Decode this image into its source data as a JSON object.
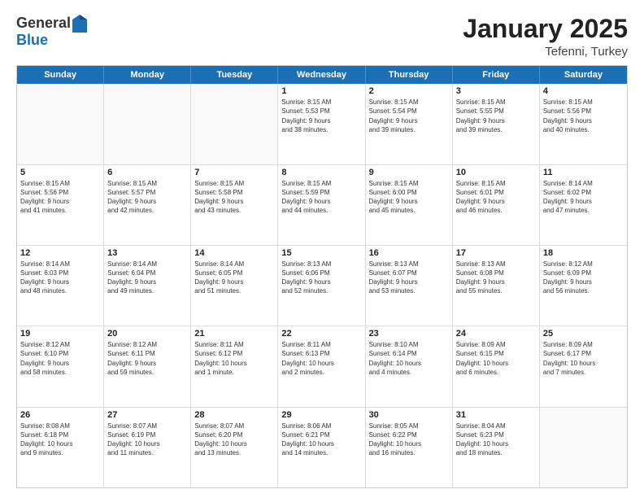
{
  "header": {
    "logo_general": "General",
    "logo_blue": "Blue",
    "month_year": "January 2025",
    "location": "Tefenni, Turkey"
  },
  "weekdays": [
    "Sunday",
    "Monday",
    "Tuesday",
    "Wednesday",
    "Thursday",
    "Friday",
    "Saturday"
  ],
  "weeks": [
    [
      {
        "day": "",
        "text": "",
        "empty": true
      },
      {
        "day": "",
        "text": "",
        "empty": true
      },
      {
        "day": "",
        "text": "",
        "empty": true
      },
      {
        "day": "1",
        "text": "Sunrise: 8:15 AM\nSunset: 5:53 PM\nDaylight: 9 hours\nand 38 minutes."
      },
      {
        "day": "2",
        "text": "Sunrise: 8:15 AM\nSunset: 5:54 PM\nDaylight: 9 hours\nand 39 minutes."
      },
      {
        "day": "3",
        "text": "Sunrise: 8:15 AM\nSunset: 5:55 PM\nDaylight: 9 hours\nand 39 minutes."
      },
      {
        "day": "4",
        "text": "Sunrise: 8:15 AM\nSunset: 5:56 PM\nDaylight: 9 hours\nand 40 minutes."
      }
    ],
    [
      {
        "day": "5",
        "text": "Sunrise: 8:15 AM\nSunset: 5:56 PM\nDaylight: 9 hours\nand 41 minutes."
      },
      {
        "day": "6",
        "text": "Sunrise: 8:15 AM\nSunset: 5:57 PM\nDaylight: 9 hours\nand 42 minutes."
      },
      {
        "day": "7",
        "text": "Sunrise: 8:15 AM\nSunset: 5:58 PM\nDaylight: 9 hours\nand 43 minutes."
      },
      {
        "day": "8",
        "text": "Sunrise: 8:15 AM\nSunset: 5:59 PM\nDaylight: 9 hours\nand 44 minutes."
      },
      {
        "day": "9",
        "text": "Sunrise: 8:15 AM\nSunset: 6:00 PM\nDaylight: 9 hours\nand 45 minutes."
      },
      {
        "day": "10",
        "text": "Sunrise: 8:15 AM\nSunset: 6:01 PM\nDaylight: 9 hours\nand 46 minutes."
      },
      {
        "day": "11",
        "text": "Sunrise: 8:14 AM\nSunset: 6:02 PM\nDaylight: 9 hours\nand 47 minutes."
      }
    ],
    [
      {
        "day": "12",
        "text": "Sunrise: 8:14 AM\nSunset: 6:03 PM\nDaylight: 9 hours\nand 48 minutes."
      },
      {
        "day": "13",
        "text": "Sunrise: 8:14 AM\nSunset: 6:04 PM\nDaylight: 9 hours\nand 49 minutes."
      },
      {
        "day": "14",
        "text": "Sunrise: 8:14 AM\nSunset: 6:05 PM\nDaylight: 9 hours\nand 51 minutes."
      },
      {
        "day": "15",
        "text": "Sunrise: 8:13 AM\nSunset: 6:06 PM\nDaylight: 9 hours\nand 52 minutes."
      },
      {
        "day": "16",
        "text": "Sunrise: 8:13 AM\nSunset: 6:07 PM\nDaylight: 9 hours\nand 53 minutes."
      },
      {
        "day": "17",
        "text": "Sunrise: 8:13 AM\nSunset: 6:08 PM\nDaylight: 9 hours\nand 55 minutes."
      },
      {
        "day": "18",
        "text": "Sunrise: 8:12 AM\nSunset: 6:09 PM\nDaylight: 9 hours\nand 56 minutes."
      }
    ],
    [
      {
        "day": "19",
        "text": "Sunrise: 8:12 AM\nSunset: 6:10 PM\nDaylight: 9 hours\nand 58 minutes."
      },
      {
        "day": "20",
        "text": "Sunrise: 8:12 AM\nSunset: 6:11 PM\nDaylight: 9 hours\nand 59 minutes."
      },
      {
        "day": "21",
        "text": "Sunrise: 8:11 AM\nSunset: 6:12 PM\nDaylight: 10 hours\nand 1 minute."
      },
      {
        "day": "22",
        "text": "Sunrise: 8:11 AM\nSunset: 6:13 PM\nDaylight: 10 hours\nand 2 minutes."
      },
      {
        "day": "23",
        "text": "Sunrise: 8:10 AM\nSunset: 6:14 PM\nDaylight: 10 hours\nand 4 minutes."
      },
      {
        "day": "24",
        "text": "Sunrise: 8:09 AM\nSunset: 6:15 PM\nDaylight: 10 hours\nand 6 minutes."
      },
      {
        "day": "25",
        "text": "Sunrise: 8:09 AM\nSunset: 6:17 PM\nDaylight: 10 hours\nand 7 minutes."
      }
    ],
    [
      {
        "day": "26",
        "text": "Sunrise: 8:08 AM\nSunset: 6:18 PM\nDaylight: 10 hours\nand 9 minutes."
      },
      {
        "day": "27",
        "text": "Sunrise: 8:07 AM\nSunset: 6:19 PM\nDaylight: 10 hours\nand 11 minutes."
      },
      {
        "day": "28",
        "text": "Sunrise: 8:07 AM\nSunset: 6:20 PM\nDaylight: 10 hours\nand 13 minutes."
      },
      {
        "day": "29",
        "text": "Sunrise: 8:06 AM\nSunset: 6:21 PM\nDaylight: 10 hours\nand 14 minutes."
      },
      {
        "day": "30",
        "text": "Sunrise: 8:05 AM\nSunset: 6:22 PM\nDaylight: 10 hours\nand 16 minutes."
      },
      {
        "day": "31",
        "text": "Sunrise: 8:04 AM\nSunset: 6:23 PM\nDaylight: 10 hours\nand 18 minutes."
      },
      {
        "day": "",
        "text": "",
        "empty": true
      }
    ]
  ]
}
